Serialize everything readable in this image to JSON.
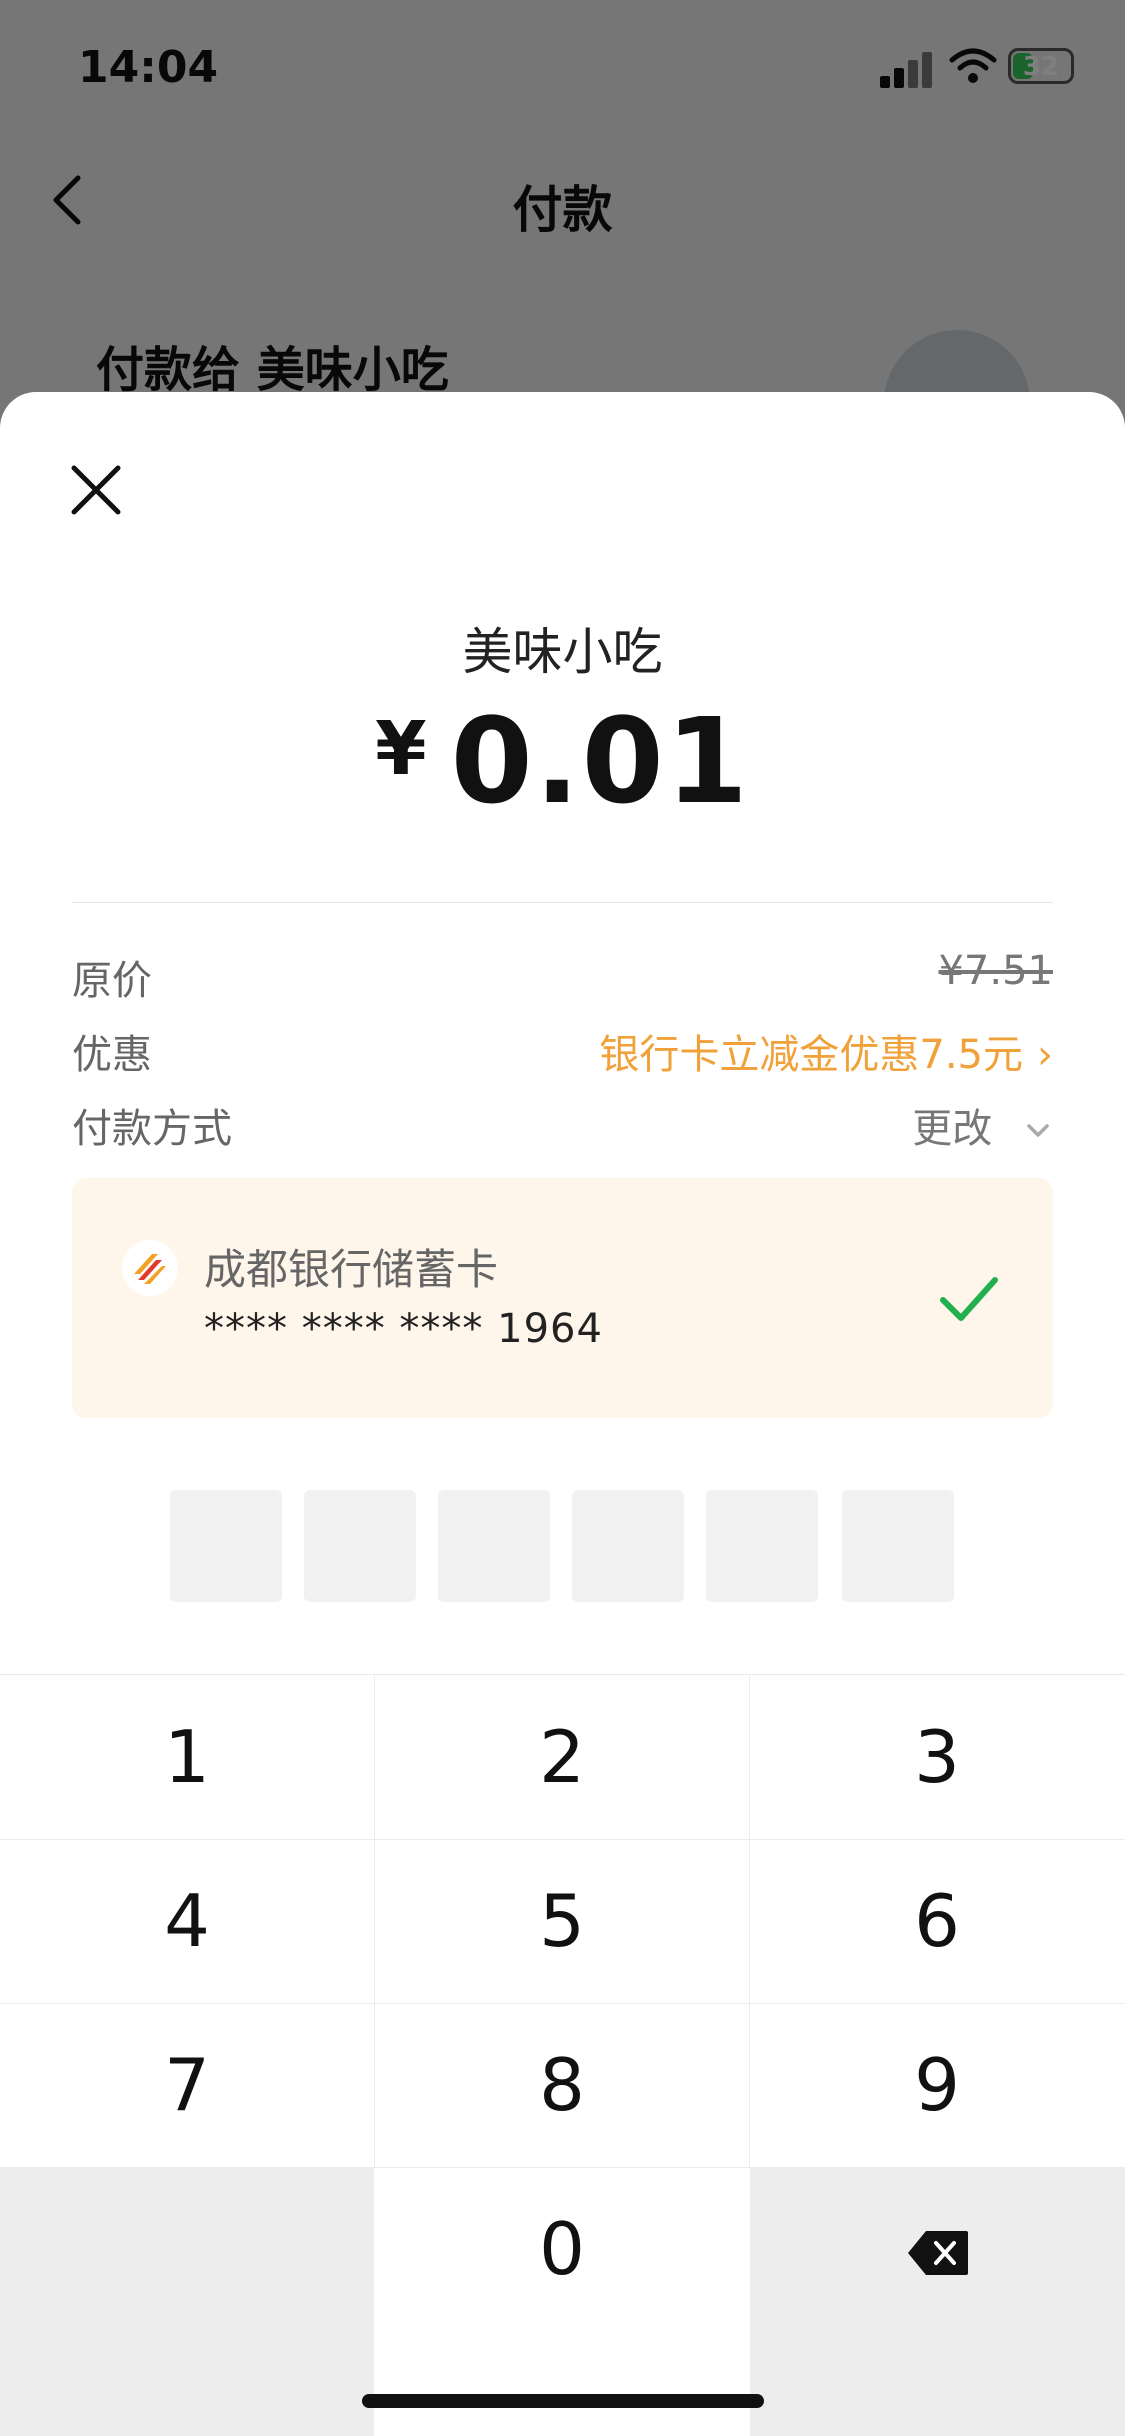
{
  "status_bar": {
    "time": "14:04",
    "battery": "32"
  },
  "nav": {
    "title": "付款"
  },
  "background": {
    "payee": "付款给 美味小吃"
  },
  "sheet": {
    "merchant": "美味小吃",
    "currency": "¥",
    "amount": "0.01",
    "original_label": "原价",
    "original_value": "¥7.51",
    "discount_label": "优惠",
    "discount_value": "银行卡立减金优惠7.5元",
    "method_label": "付款方式",
    "change_label": "更改",
    "card": {
      "bank": "成都银行储蓄卡",
      "number": "**** **** **** 1964"
    }
  },
  "keypad": {
    "keys": [
      "1",
      "2",
      "3",
      "4",
      "5",
      "6",
      "7",
      "8",
      "9",
      "0"
    ]
  },
  "colors": {
    "accent_orange": "#f1a13a",
    "check_green": "#21b04b",
    "card_bg": "#fff6eb"
  }
}
